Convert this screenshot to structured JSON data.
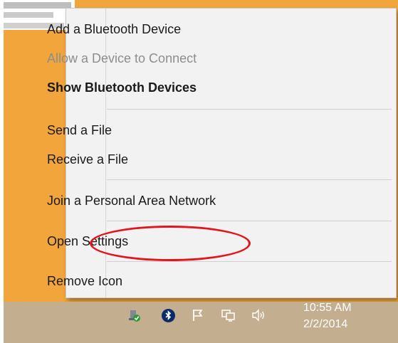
{
  "desktop": {
    "wallpaper_color": "#f2a53a"
  },
  "menu": {
    "items": [
      {
        "label": "Add a Bluetooth Device",
        "enabled": true,
        "bold": false
      },
      {
        "label": "Allow a Device to Connect",
        "enabled": false,
        "bold": false
      },
      {
        "label": "Show Bluetooth Devices",
        "enabled": true,
        "bold": true
      },
      {
        "label": "Send a File",
        "enabled": true,
        "bold": false
      },
      {
        "label": "Receive a File",
        "enabled": true,
        "bold": false
      },
      {
        "label": "Join a Personal Area Network",
        "enabled": true,
        "bold": false
      },
      {
        "label": "Open Settings",
        "enabled": true,
        "bold": false,
        "highlighted": true
      },
      {
        "label": "Remove Icon",
        "enabled": true,
        "bold": false
      }
    ]
  },
  "taskbar": {
    "tray_icons": [
      "network-icon",
      "bluetooth-icon",
      "action-center-flag-icon",
      "display-icon",
      "volume-icon"
    ],
    "clock": {
      "time": "10:55 AM",
      "date": "2/2/2014"
    }
  },
  "annotation": {
    "color": "#e0161c",
    "target": "Open Settings"
  }
}
